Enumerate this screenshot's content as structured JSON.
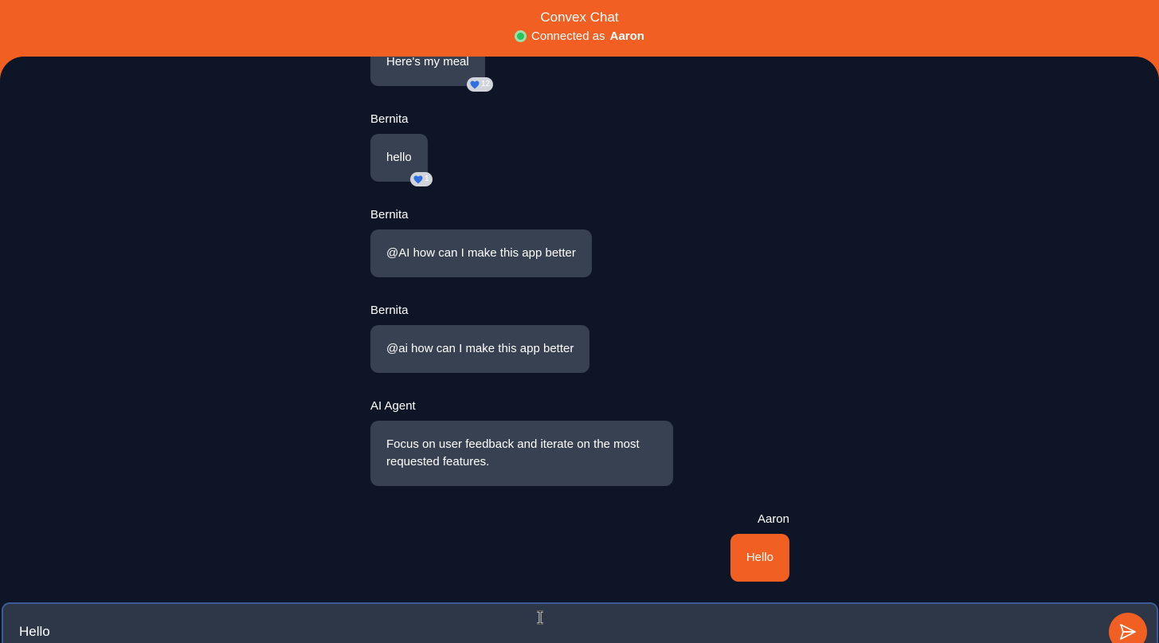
{
  "header": {
    "title": "Convex Chat",
    "status_prefix": "Connected as",
    "user_name": "Aaron",
    "status_color": "#22c55e"
  },
  "messages": [
    {
      "sender": "",
      "text": "Here's my meal",
      "reaction": {
        "icon": "blue-heart-icon",
        "count": "12"
      }
    },
    {
      "sender": "Bernita",
      "text": "hello",
      "reaction": {
        "icon": "blue-heart-icon",
        "count": "1"
      }
    },
    {
      "sender": "Bernita",
      "text": "@AI how can I make this app better"
    },
    {
      "sender": "Bernita",
      "text": "@ai how can I make this app better"
    },
    {
      "sender": "AI Agent",
      "text": "Focus on user feedback and iterate on the most requested features."
    },
    {
      "sender": "Aaron",
      "text": "Hello",
      "self": true
    }
  ],
  "composer": {
    "value": "Hello",
    "send_icon": "paper-plane-icon"
  },
  "colors": {
    "accent": "#f15f22",
    "background": "#0d1526",
    "bubble": "#374151",
    "composer": "#2d3748"
  }
}
